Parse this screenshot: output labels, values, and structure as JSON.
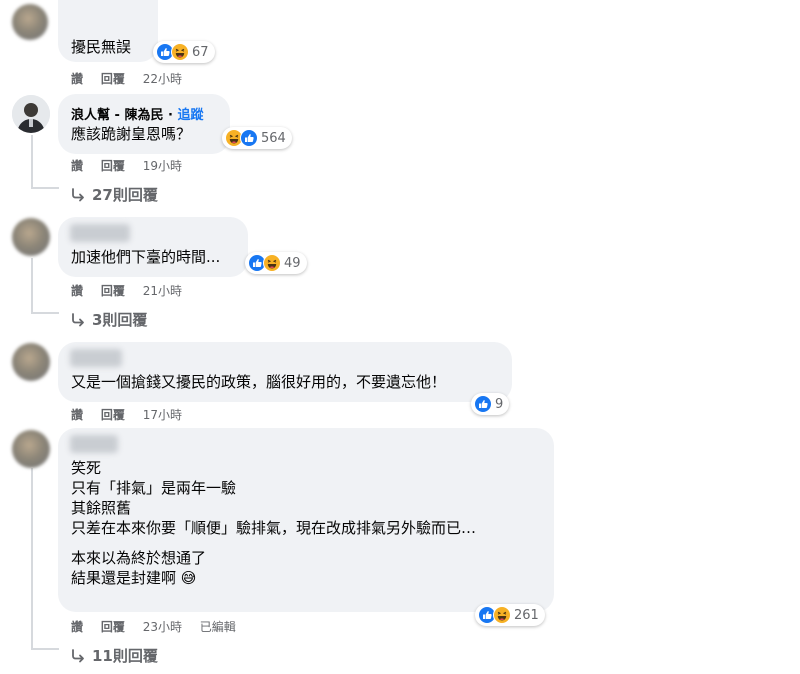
{
  "comments": [
    {
      "author": "",
      "text": [
        "擾民無誤"
      ],
      "reactions": {
        "icons": [
          "like-icon",
          "haha-icon"
        ],
        "count": "67"
      },
      "actions": {
        "like": "讚",
        "reply": "回覆",
        "time": "22小時"
      }
    },
    {
      "author": "浪人幫 - 陳為民",
      "follow": "追蹤",
      "text": [
        "應該跪謝皇恩嗎？"
      ],
      "reactions": {
        "icons": [
          "haha-icon",
          "like-icon"
        ],
        "count": "564"
      },
      "actions": {
        "like": "讚",
        "reply": "回覆",
        "time": "19小時"
      },
      "replies": "27則回覆"
    },
    {
      "author": "",
      "text": [
        "加速他們下臺的時間..."
      ],
      "reactions": {
        "icons": [
          "like-icon",
          "haha-icon"
        ],
        "count": "49"
      },
      "actions": {
        "like": "讚",
        "reply": "回覆",
        "time": "21小時"
      },
      "replies": "3則回覆"
    },
    {
      "author": "",
      "text": [
        "又是一個搶錢又擾民的政策，腦很好用的，不要遺忘他！"
      ],
      "reactions": {
        "icons": [
          "like-icon"
        ],
        "count": "9"
      },
      "actions": {
        "like": "讚",
        "reply": "回覆",
        "time": "17小時"
      }
    },
    {
      "author": "",
      "text": [
        "笑死",
        "只有「排氣」是兩年一驗",
        "其餘照舊",
        "只差在本來你要「順便」驗排氣，現在改成排氣另外驗而已…",
        "本來以為終於想通了",
        "結果還是封建啊 😅"
      ],
      "reactions": {
        "icons": [
          "like-icon",
          "haha-icon"
        ],
        "count": "261"
      },
      "actions": {
        "like": "讚",
        "reply": "回覆",
        "time": "23小時",
        "edited": "已編輯"
      },
      "replies": "11則回覆"
    }
  ],
  "colors": {
    "like_blue": "#1877f2",
    "haha_yellow": "#f7b125",
    "bubble": "#f0f2f5",
    "meta_gray": "#65676b"
  }
}
